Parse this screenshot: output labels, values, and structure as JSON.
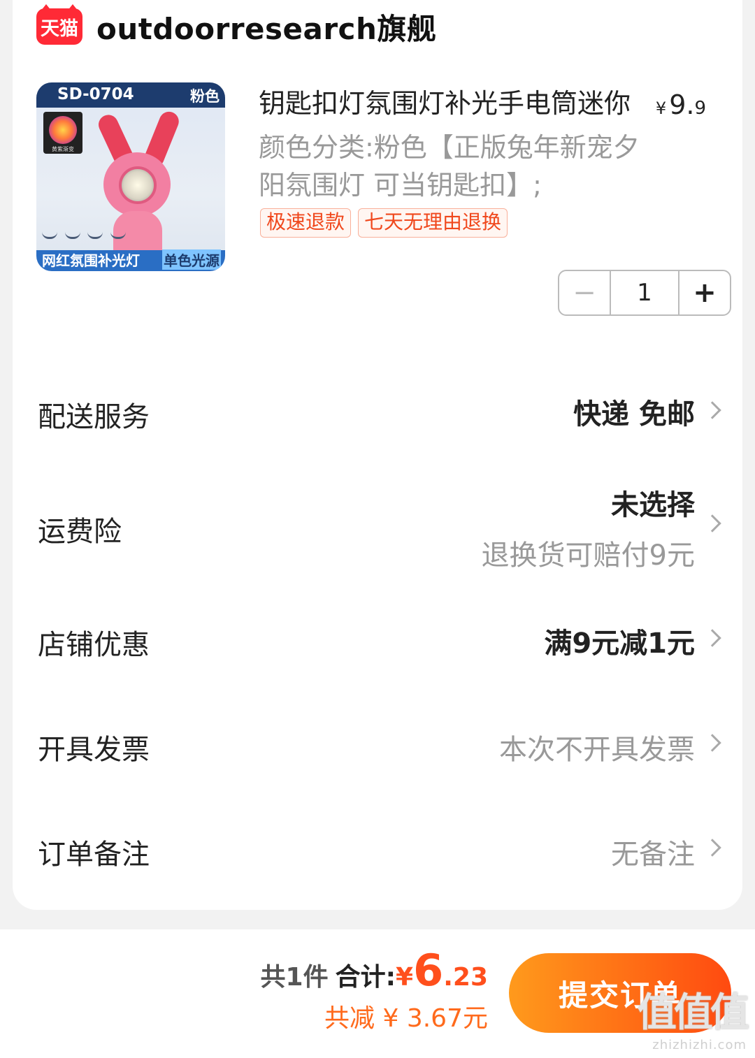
{
  "shop": {
    "logo_text": "天猫",
    "name": "outdoorresearch旗舰"
  },
  "product": {
    "thumbnail": {
      "model": "SD-0704",
      "color_tag": "粉色",
      "sunset_label": "黄紫渐变",
      "banner_left": "网红氛围补光灯",
      "banner_right": "单色光源"
    },
    "title": "钥匙扣灯氛围灯补光手电筒迷你",
    "price_symbol": "¥",
    "price_int": "9.",
    "price_dec": "9",
    "sku": "颜色分类:粉色【正版兔年新宠夕阳氛围灯 可当钥匙扣】;",
    "tags": [
      "极速退款",
      "七天无理由退换"
    ],
    "quantity": "1",
    "minus_symbol": "−",
    "plus_symbol": "+"
  },
  "rows": {
    "delivery": {
      "label": "配送服务",
      "value": "快递 免邮"
    },
    "insurance": {
      "label": "运费险",
      "value": "未选择",
      "sub": "退换货可赔付9元"
    },
    "coupon": {
      "label": "店铺优惠",
      "value": "满9元减1元"
    },
    "invoice": {
      "label": "开具发票",
      "value": "本次不开具发票"
    },
    "remark": {
      "label": "订单备注",
      "value": "无备注"
    }
  },
  "footer": {
    "count_text": "共1件",
    "total_label": "合计:",
    "total_yen": "¥",
    "total_int": "6",
    "total_dec": ".23",
    "saved_text": "共减 ¥ 3.67元",
    "submit_label": "提交订单"
  },
  "watermark": {
    "main": "值值值",
    "sub": "zhizhizhi.com"
  },
  "colors": {
    "accent": "#ff4f1c",
    "tmall_red": "#ff2a36",
    "tag_text": "#f0481d",
    "button_gradient_start": "#ff9a1c",
    "button_gradient_end": "#ff4a10"
  }
}
